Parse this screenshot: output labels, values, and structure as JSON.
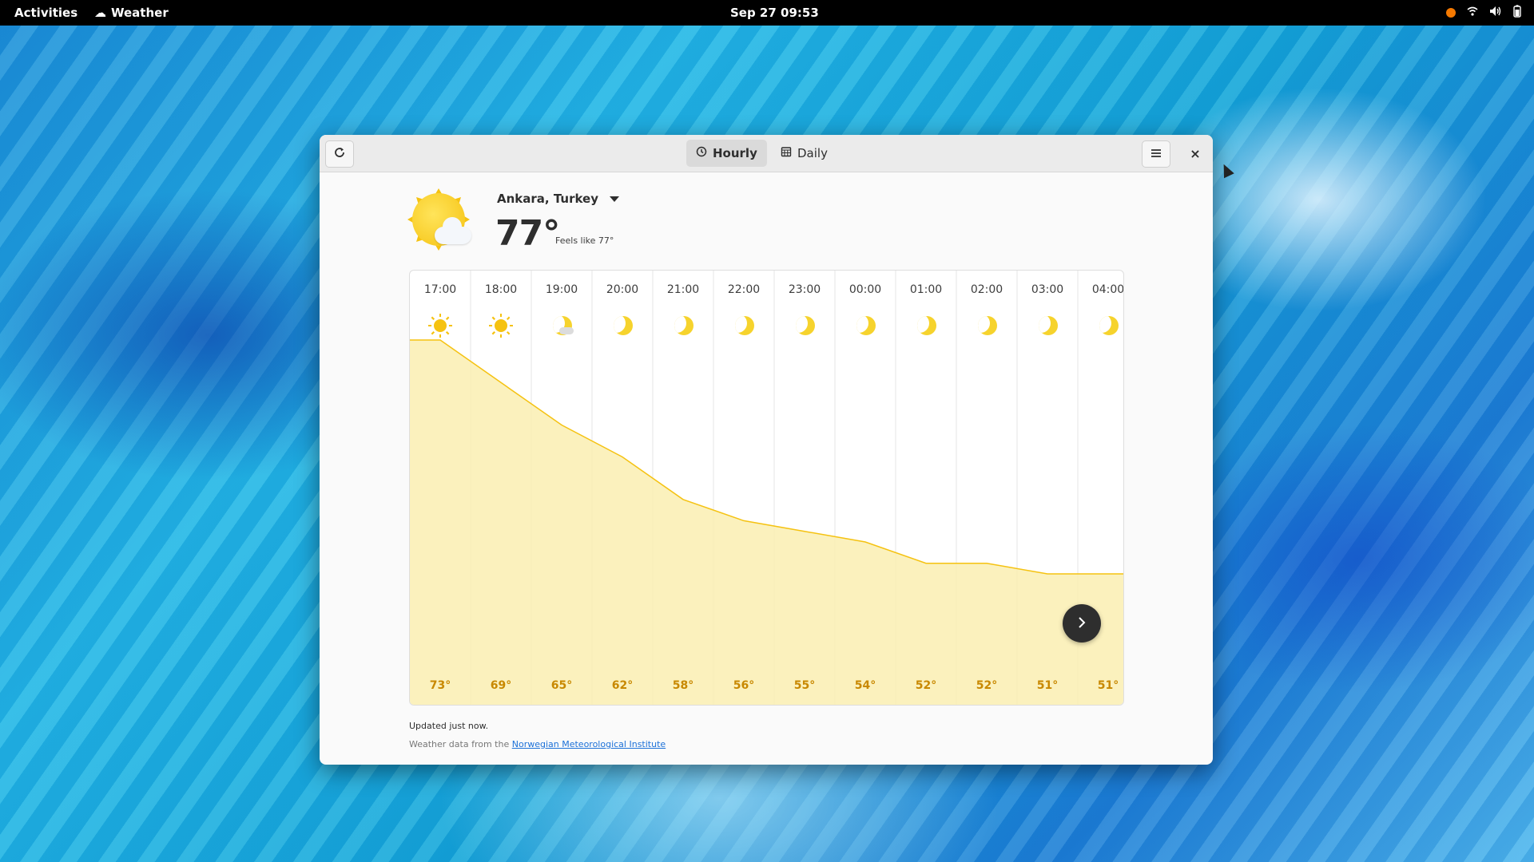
{
  "topbar": {
    "activities": "Activities",
    "app_name": "Weather",
    "clock": "Sep 27  09:53",
    "tray_icons": [
      "status-dot-orange",
      "wifi-icon",
      "volume-icon",
      "battery-icon"
    ]
  },
  "window": {
    "refresh_icon": "refresh-icon",
    "tabs": [
      {
        "label": "Hourly",
        "icon": "clock-icon",
        "active": true
      },
      {
        "label": "Daily",
        "icon": "calendar-icon",
        "active": false
      }
    ],
    "menu_icon": "hamburger-icon",
    "close_label": "×"
  },
  "current": {
    "location": "Ankara, Turkey",
    "temperature": "77°",
    "feels_like": "Feels like 77°",
    "condition_icon": "sun-with-cloud-icon"
  },
  "hourly": {
    "hours": [
      {
        "time": "17:00",
        "icon": "sun",
        "temp": "73°"
      },
      {
        "time": "18:00",
        "icon": "sun",
        "temp": "69°"
      },
      {
        "time": "19:00",
        "icon": "moon-cloud",
        "temp": "65°"
      },
      {
        "time": "20:00",
        "icon": "moon",
        "temp": "62°"
      },
      {
        "time": "21:00",
        "icon": "moon",
        "temp": "58°"
      },
      {
        "time": "22:00",
        "icon": "moon",
        "temp": "56°"
      },
      {
        "time": "23:00",
        "icon": "moon",
        "temp": "55°"
      },
      {
        "time": "00:00",
        "icon": "moon",
        "temp": "54°"
      },
      {
        "time": "01:00",
        "icon": "moon",
        "temp": "52°"
      },
      {
        "time": "02:00",
        "icon": "moon",
        "temp": "52°"
      },
      {
        "time": "03:00",
        "icon": "moon",
        "temp": "51°"
      },
      {
        "time": "04:00",
        "icon": "moon",
        "temp": "51°"
      }
    ],
    "next_icon": "chevron-right-icon"
  },
  "footer": {
    "updated": "Updated just now.",
    "attribution_prefix": "Weather data from the ",
    "attribution_link": "Norwegian Meteorological Institute"
  },
  "colors": {
    "accent": "#f5c211",
    "temp_label": "#c88800",
    "area_fill": "#faeeb1"
  }
}
